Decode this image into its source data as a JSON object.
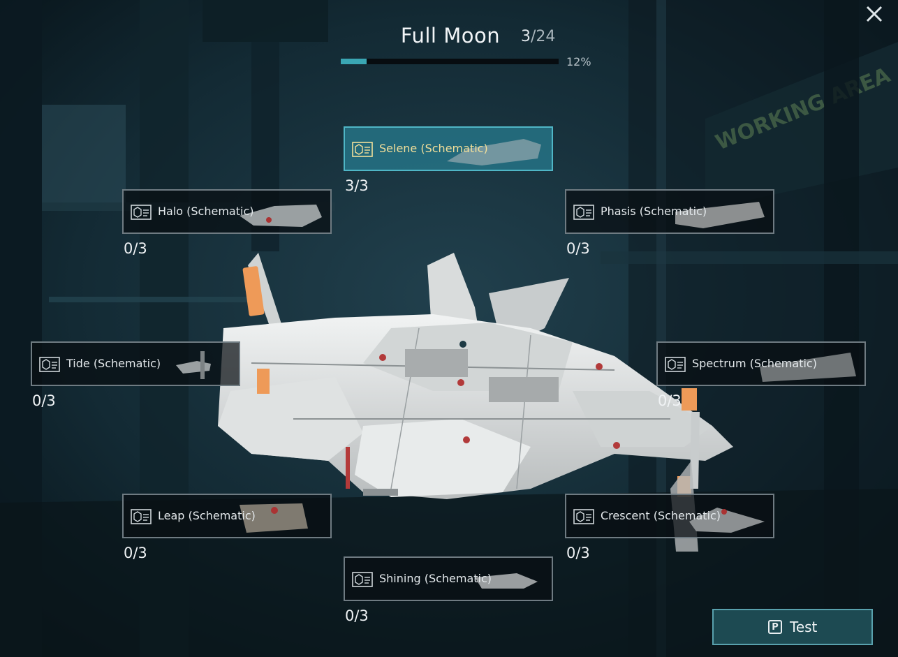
{
  "header": {
    "title": "Full Moon",
    "collected": "3",
    "total": "/24",
    "progress_percent": 12,
    "progress_label": "12%"
  },
  "slots": [
    {
      "label": "Selene (Schematic)",
      "qty": "3/3",
      "selected": true
    },
    {
      "label": "Halo (Schematic)",
      "qty": "0/3"
    },
    {
      "label": "Phasis (Schematic)",
      "qty": "0/3"
    },
    {
      "label": "Tide (Schematic)",
      "qty": "0/3"
    },
    {
      "label": "Spectrum (Schematic)",
      "qty": "0/3"
    },
    {
      "label": "Leap (Schematic)",
      "qty": "0/3"
    },
    {
      "label": "Crescent (Schematic)",
      "qty": "0/3"
    },
    {
      "label": "Shining (Schematic)",
      "qty": "0/3"
    }
  ],
  "background": {
    "sign_text": "WORKING AREA"
  },
  "test_button": {
    "key": "P",
    "label": "Test"
  },
  "icons": {
    "close": "close-icon",
    "slot": "schematic-box-icon"
  },
  "colors": {
    "accent": "#3aa6b3",
    "selected_text": "#f2df9a",
    "button_bg": "#1d4a52"
  }
}
